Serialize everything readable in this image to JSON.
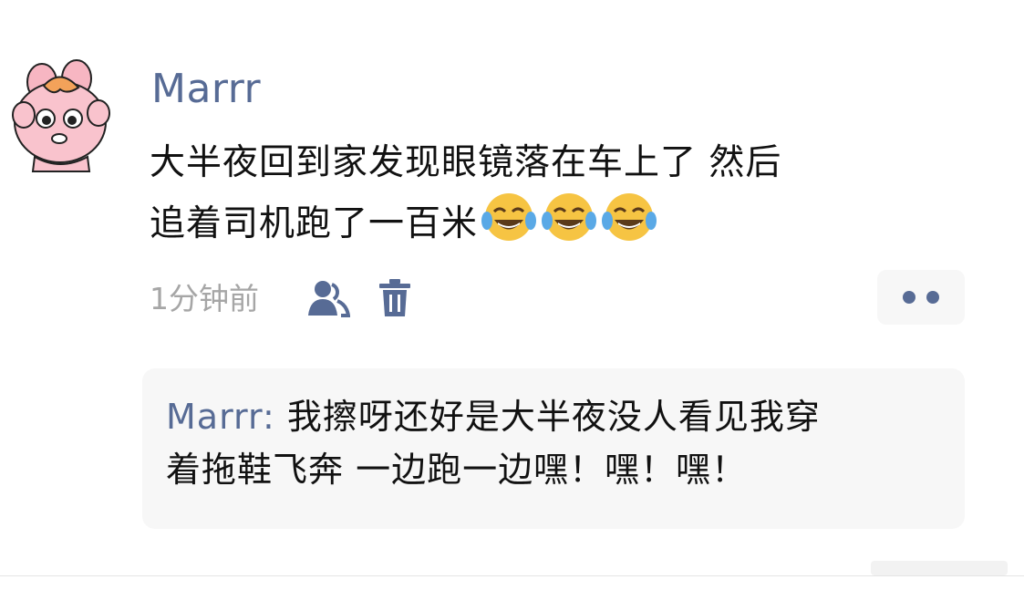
{
  "post": {
    "author": "Marrr",
    "text_line1": "大半夜回到家发现眼镜落在车上了 然后",
    "text_line2": "追着司机跑了一百米",
    "emojis": [
      "tears-of-joy-emoji",
      "tears-of-joy-emoji",
      "tears-of-joy-emoji"
    ],
    "timestamp": "1分钟前",
    "icons": {
      "visibility": "friends-icon",
      "delete": "trash-icon",
      "more": "more-dots-icon"
    }
  },
  "comment": {
    "author": "Marrr",
    "separator": ": ",
    "text_line1": "我擦呀还好是大半夜没人看见我穿",
    "text_line2": "着拖鞋飞奔 一边跑一边嘿！嘿！嘿！"
  },
  "colors": {
    "link_blue": "#576b95",
    "muted_gray": "#a6a6a6",
    "comment_bg": "#f7f7f7",
    "emoji_yellow": "#f6c443",
    "tear_blue": "#5aa9e6"
  }
}
